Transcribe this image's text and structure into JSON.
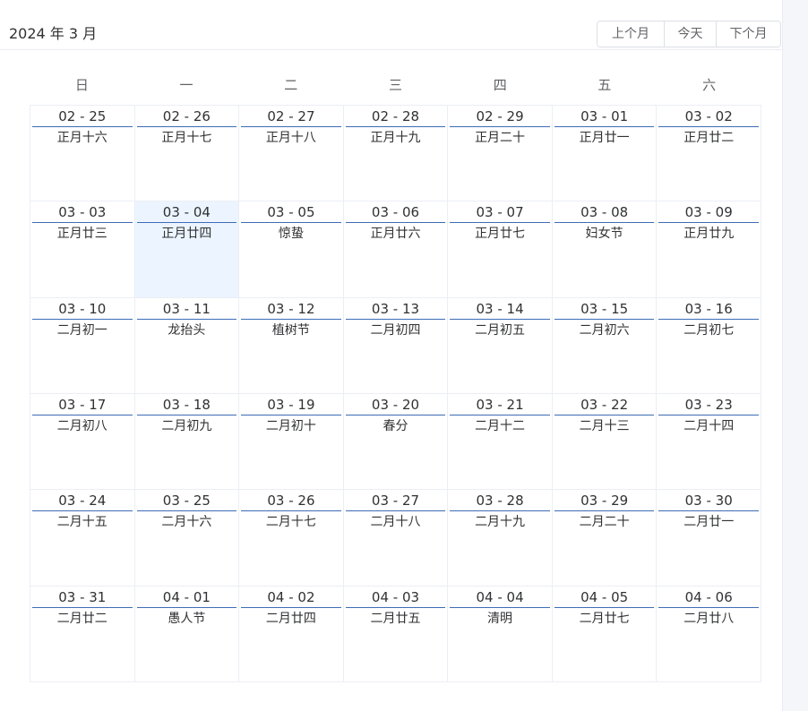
{
  "header": {
    "title": "2024 年 3 月",
    "prev_label": "上个月",
    "today_label": "今天",
    "next_label": "下个月"
  },
  "weekdays": [
    "日",
    "一",
    "二",
    "三",
    "四",
    "五",
    "六"
  ],
  "selected_date": "03 - 04",
  "colors": {
    "accent_line": "#3d6cb6",
    "selected_bg": "#ecf5ff",
    "border": "#ebeef5"
  },
  "days": [
    {
      "date": "02 - 25",
      "lunar": "正月十六"
    },
    {
      "date": "02 - 26",
      "lunar": "正月十七"
    },
    {
      "date": "02 - 27",
      "lunar": "正月十八"
    },
    {
      "date": "02 - 28",
      "lunar": "正月十九"
    },
    {
      "date": "02 - 29",
      "lunar": "正月二十"
    },
    {
      "date": "03 - 01",
      "lunar": "正月廿一"
    },
    {
      "date": "03 - 02",
      "lunar": "正月廿二"
    },
    {
      "date": "03 - 03",
      "lunar": "正月廿三"
    },
    {
      "date": "03 - 04",
      "lunar": "正月廿四"
    },
    {
      "date": "03 - 05",
      "lunar": "惊蛰"
    },
    {
      "date": "03 - 06",
      "lunar": "正月廿六"
    },
    {
      "date": "03 - 07",
      "lunar": "正月廿七"
    },
    {
      "date": "03 - 08",
      "lunar": "妇女节"
    },
    {
      "date": "03 - 09",
      "lunar": "正月廿九"
    },
    {
      "date": "03 - 10",
      "lunar": "二月初一"
    },
    {
      "date": "03 - 11",
      "lunar": "龙抬头"
    },
    {
      "date": "03 - 12",
      "lunar": "植树节"
    },
    {
      "date": "03 - 13",
      "lunar": "二月初四"
    },
    {
      "date": "03 - 14",
      "lunar": "二月初五"
    },
    {
      "date": "03 - 15",
      "lunar": "二月初六"
    },
    {
      "date": "03 - 16",
      "lunar": "二月初七"
    },
    {
      "date": "03 - 17",
      "lunar": "二月初八"
    },
    {
      "date": "03 - 18",
      "lunar": "二月初九"
    },
    {
      "date": "03 - 19",
      "lunar": "二月初十"
    },
    {
      "date": "03 - 20",
      "lunar": "春分"
    },
    {
      "date": "03 - 21",
      "lunar": "二月十二"
    },
    {
      "date": "03 - 22",
      "lunar": "二月十三"
    },
    {
      "date": "03 - 23",
      "lunar": "二月十四"
    },
    {
      "date": "03 - 24",
      "lunar": "二月十五"
    },
    {
      "date": "03 - 25",
      "lunar": "二月十六"
    },
    {
      "date": "03 - 26",
      "lunar": "二月十七"
    },
    {
      "date": "03 - 27",
      "lunar": "二月十八"
    },
    {
      "date": "03 - 28",
      "lunar": "二月十九"
    },
    {
      "date": "03 - 29",
      "lunar": "二月二十"
    },
    {
      "date": "03 - 30",
      "lunar": "二月廿一"
    },
    {
      "date": "03 - 31",
      "lunar": "二月廿二"
    },
    {
      "date": "04 - 01",
      "lunar": "愚人节"
    },
    {
      "date": "04 - 02",
      "lunar": "二月廿四"
    },
    {
      "date": "04 - 03",
      "lunar": "二月廿五"
    },
    {
      "date": "04 - 04",
      "lunar": "清明"
    },
    {
      "date": "04 - 05",
      "lunar": "二月廿七"
    },
    {
      "date": "04 - 06",
      "lunar": "二月廿八"
    }
  ]
}
